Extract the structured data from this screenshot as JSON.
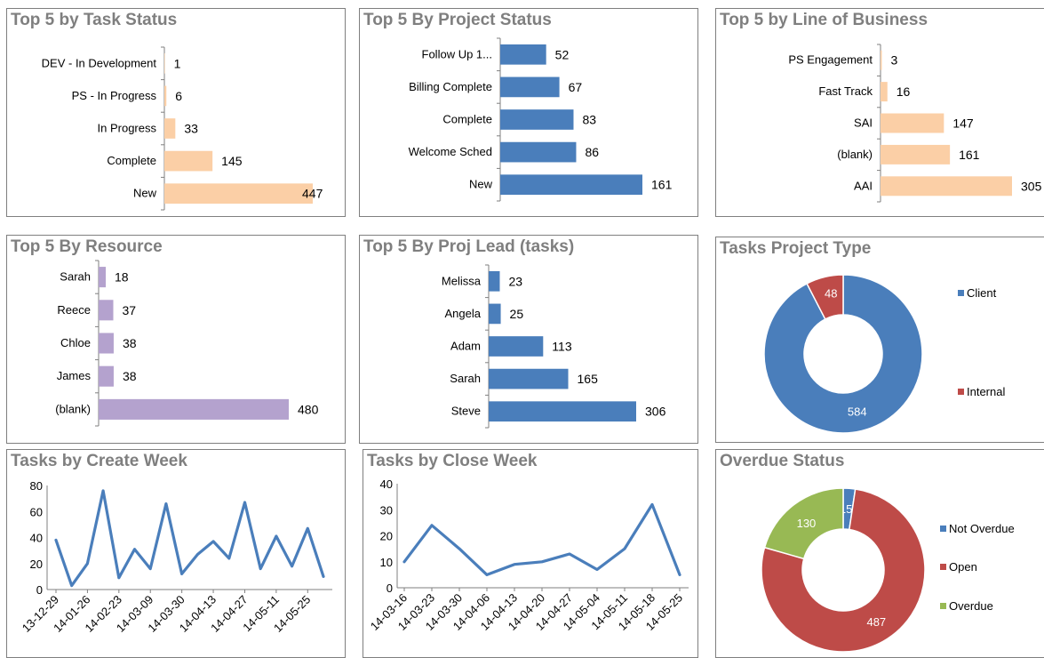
{
  "colors": {
    "orange": "#fbcfa6",
    "blue": "#4a7ebb",
    "purple": "#b4a2ce",
    "red": "#be4b48",
    "green": "#98b954",
    "title": "#7f7f7f"
  },
  "chart_data": [
    {
      "type": "bar",
      "orientation": "horizontal",
      "title": "Top 5 by Task Status",
      "color": "#fbcfa6",
      "categories": [
        "DEV - In Development",
        "PS - In Progress",
        "In Progress",
        "Complete",
        "New"
      ],
      "values": [
        1,
        6,
        33,
        145,
        447
      ]
    },
    {
      "type": "bar",
      "orientation": "horizontal",
      "title": "Top 5 By Project Status",
      "color": "#4a7ebb",
      "categories": [
        "Follow Up 1...",
        "Billing Complete",
        "Complete",
        "Welcome Sched",
        "New"
      ],
      "values": [
        52,
        67,
        83,
        86,
        161
      ]
    },
    {
      "type": "bar",
      "orientation": "horizontal",
      "title": "Top 5 by Line of Business",
      "color": "#fbcfa6",
      "categories": [
        "PS Engagement",
        "Fast Track",
        "SAI",
        "(blank)",
        "AAI"
      ],
      "values": [
        3,
        16,
        147,
        161,
        305
      ]
    },
    {
      "type": "bar",
      "orientation": "horizontal",
      "title": "Top 5 By Resource",
      "color": "#b4a2ce",
      "categories": [
        "Sarah",
        "Reece",
        "Chloe",
        "James",
        "(blank)"
      ],
      "values": [
        18,
        37,
        38,
        38,
        480
      ]
    },
    {
      "type": "bar",
      "orientation": "horizontal",
      "title": "Top 5 By Proj Lead (tasks)",
      "color": "#4a7ebb",
      "categories": [
        "Melissa",
        "Angela",
        "Adam",
        "Sarah",
        "Steve"
      ],
      "values": [
        23,
        25,
        113,
        165,
        306
      ]
    },
    {
      "type": "pie",
      "donut": true,
      "title": "Tasks Project Type",
      "slices": [
        {
          "label": "Client",
          "value": 584,
          "color": "#4a7ebb"
        },
        {
          "label": "Internal",
          "value": 48,
          "color": "#be4b48"
        }
      ]
    },
    {
      "type": "line",
      "title": "Tasks by Create Week",
      "color": "#4a7ebb",
      "ylim": [
        0,
        80
      ],
      "yticks": [
        0,
        20,
        40,
        60,
        80
      ],
      "x_tick_labels": [
        "13-12-29",
        "14-01-26",
        "14-02-23",
        "14-03-09",
        "14-03-30",
        "14-04-13",
        "14-04-27",
        "14-05-11",
        "14-05-25"
      ],
      "values": [
        38,
        3,
        20,
        76,
        9,
        31,
        16,
        66,
        12,
        27,
        37,
        24,
        67,
        16,
        41,
        18,
        47,
        10
      ]
    },
    {
      "type": "line",
      "title": "Tasks by Close Week",
      "color": "#4a7ebb",
      "ylim": [
        0,
        40
      ],
      "yticks": [
        0,
        10,
        20,
        30,
        40
      ],
      "categories": [
        "14-03-16",
        "14-03-23",
        "14-03-30",
        "14-04-06",
        "14-04-13",
        "14-04-20",
        "14-04-27",
        "14-05-04",
        "14-05-11",
        "14-05-18",
        "14-05-25"
      ],
      "values": [
        10,
        24,
        15,
        5,
        9,
        10,
        13,
        7,
        15,
        32,
        5
      ]
    },
    {
      "type": "pie",
      "donut": true,
      "title": "Overdue Status",
      "slices": [
        {
          "label": "Not Overdue",
          "value": 15,
          "color": "#4a7ebb"
        },
        {
          "label": "Open",
          "value": 487,
          "color": "#be4b48"
        },
        {
          "label": "Overdue",
          "value": 130,
          "color": "#98b954"
        }
      ]
    }
  ]
}
